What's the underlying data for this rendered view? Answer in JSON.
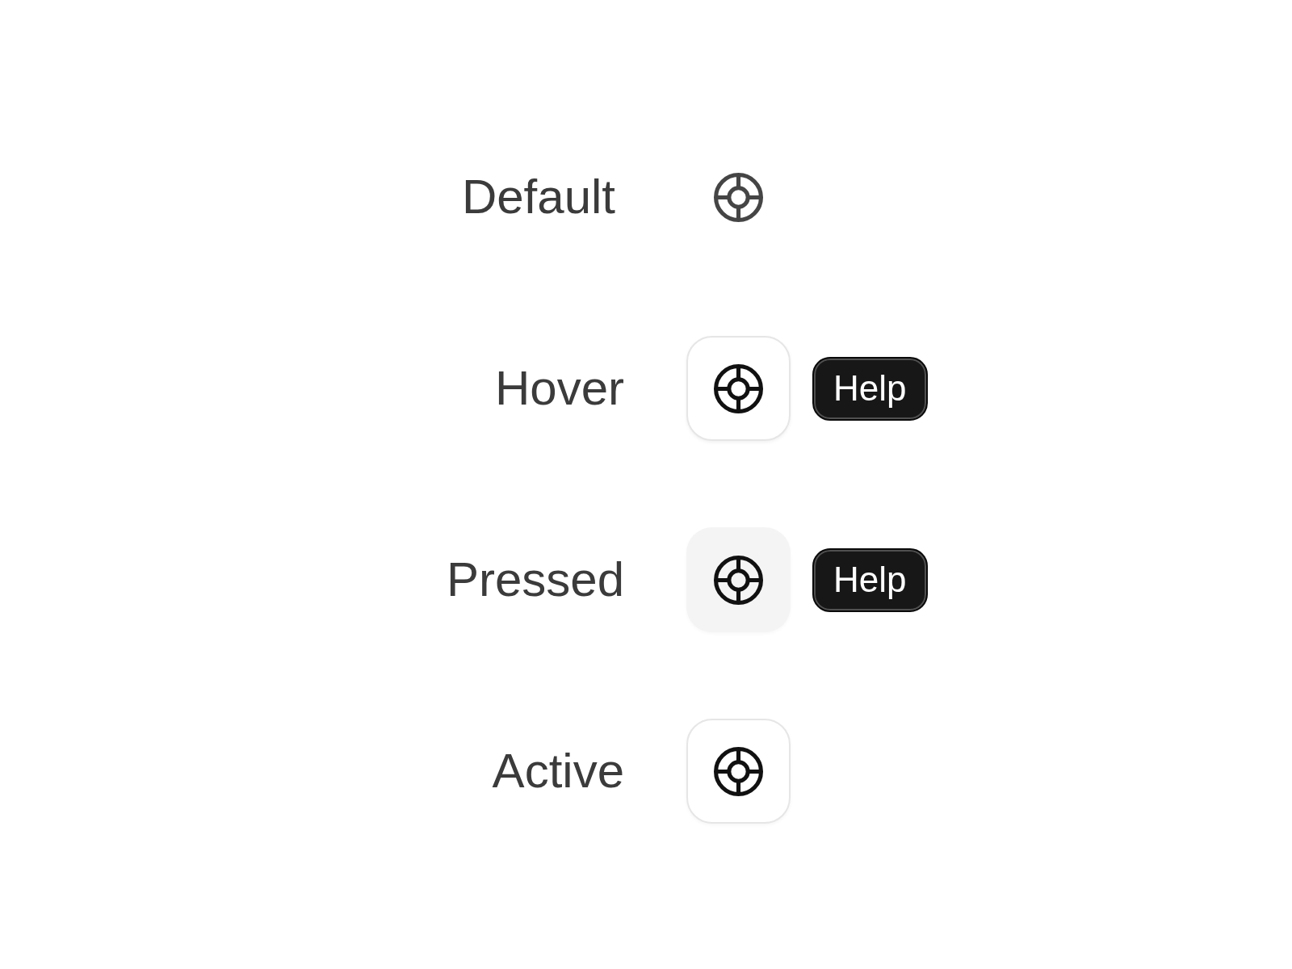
{
  "states": [
    {
      "kind": "default",
      "label": "Default"
    },
    {
      "kind": "hover",
      "label": "Hover",
      "tooltip": "Help"
    },
    {
      "kind": "pressed",
      "label": "Pressed",
      "tooltip": "Help"
    },
    {
      "kind": "active",
      "label": "Active"
    }
  ]
}
